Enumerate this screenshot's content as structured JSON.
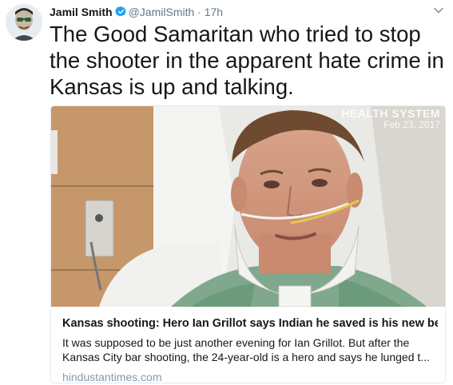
{
  "tweet": {
    "author_name": "Jamil Smith",
    "handle": "@JamilSmith",
    "separator": "·",
    "time": "17h",
    "text": "The Good Samaritan who tried to stop the shooter in the apparent hate crime in Kansas is up and talking."
  },
  "card": {
    "image_watermark_line1": "HEALTH SYSTEM",
    "image_watermark_line2": "Feb 23, 2017",
    "title": "Kansas shooting: Hero Ian Grillot says Indian he saved is his new bes...",
    "description": "It was supposed to be just another evening for Ian Grillot. But after the Kansas City bar shooting, the 24-year-old is a hero and says he lunged t...",
    "domain": "hindustantimes.com"
  },
  "icons": {
    "verified": "verified-badge-icon",
    "menu": "chevron-down-icon"
  },
  "colors": {
    "verified": "#1da1f2",
    "secondary_text": "#657786",
    "domain_text": "#8899a6",
    "card_border": "#e1e8ed"
  }
}
